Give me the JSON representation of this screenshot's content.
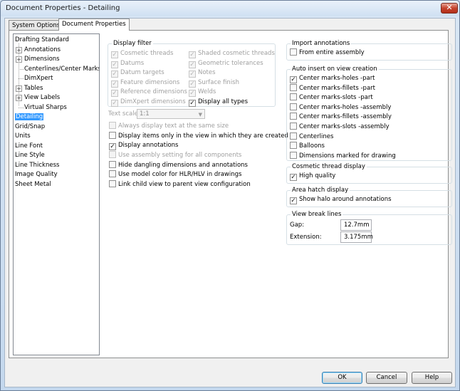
{
  "window": {
    "title": "Document Properties - Detailing",
    "close_glyph": "✕"
  },
  "tabs": [
    {
      "label": "System Options"
    },
    {
      "label": "Document Properties"
    }
  ],
  "tree": {
    "items": [
      {
        "label": "Drafting Standard"
      },
      {
        "label": "Annotations"
      },
      {
        "label": "Dimensions"
      },
      {
        "label": "Centerlines/Center Marks"
      },
      {
        "label": "DimXpert"
      },
      {
        "label": "Tables"
      },
      {
        "label": "View Labels"
      },
      {
        "label": "Virtual Sharps"
      },
      {
        "label": "Detailing",
        "selected": true
      },
      {
        "label": "Grid/Snap"
      },
      {
        "label": "Units"
      },
      {
        "label": "Line Font"
      },
      {
        "label": "Line Style"
      },
      {
        "label": "Line Thickness"
      },
      {
        "label": "Image Quality"
      },
      {
        "label": "Sheet Metal"
      }
    ],
    "expander_glyph": "+"
  },
  "display_filter": {
    "title": "Display filter",
    "left": [
      {
        "label": "Cosmetic threads",
        "checked": true,
        "enabled": false
      },
      {
        "label": "Datums",
        "checked": true,
        "enabled": false
      },
      {
        "label": "Datum targets",
        "checked": true,
        "enabled": false
      },
      {
        "label": "Feature dimensions",
        "checked": true,
        "enabled": false
      },
      {
        "label": "Reference dimensions",
        "checked": true,
        "enabled": false
      },
      {
        "label": "DimXpert dimensions",
        "checked": true,
        "enabled": false
      }
    ],
    "right": [
      {
        "label": "Shaded cosmetic threads",
        "checked": true,
        "enabled": false
      },
      {
        "label": "Geometric tolerances",
        "checked": true,
        "enabled": false
      },
      {
        "label": "Notes",
        "checked": true,
        "enabled": false
      },
      {
        "label": "Surface finish",
        "checked": true,
        "enabled": false
      },
      {
        "label": "Welds",
        "checked": true,
        "enabled": false
      },
      {
        "label": "Display all types",
        "checked": true,
        "enabled": true
      }
    ]
  },
  "text_scale": {
    "label": "Text scale:",
    "value": "1:1"
  },
  "options": [
    {
      "label": "Always display text at the same size",
      "checked": false,
      "enabled": false
    },
    {
      "label": "Display items only in the view in which they are created",
      "checked": false,
      "enabled": true
    },
    {
      "label": "Display annotations",
      "checked": true,
      "enabled": true
    },
    {
      "label": "Use assembly setting for all components",
      "checked": false,
      "enabled": false
    },
    {
      "label": "Hide dangling dimensions and annotations",
      "checked": false,
      "enabled": true
    },
    {
      "label": "Use model color for HLR/HLV in drawings",
      "checked": false,
      "enabled": true
    },
    {
      "label": "Link child view to parent view configuration",
      "checked": false,
      "enabled": true
    }
  ],
  "import_annotations": {
    "title": "Import annotations",
    "items": [
      {
        "label": "From entire assembly",
        "checked": false
      }
    ]
  },
  "auto_insert": {
    "title": "Auto insert on view creation",
    "items": [
      {
        "label": "Center marks-holes -part",
        "checked": true
      },
      {
        "label": "Center marks-fillets -part",
        "checked": false
      },
      {
        "label": "Center marks-slots  -part",
        "checked": false
      },
      {
        "label": "Center marks-holes -assembly",
        "checked": false
      },
      {
        "label": "Center marks-fillets -assembly",
        "checked": false
      },
      {
        "label": "Center marks-slots -assembly",
        "checked": false
      },
      {
        "label": "Centerlines",
        "checked": false
      },
      {
        "label": "Balloons",
        "checked": false
      },
      {
        "label": "Dimensions marked for drawing",
        "checked": false
      }
    ]
  },
  "cosmetic_thread": {
    "title": "Cosmetic thread display",
    "items": [
      {
        "label": "High quality",
        "checked": true
      }
    ]
  },
  "area_hatch": {
    "title": "Area hatch display",
    "items": [
      {
        "label": "Show halo around annotations",
        "checked": true
      }
    ]
  },
  "view_break": {
    "title": "View break lines",
    "gap_label": "Gap:",
    "gap_value": "12.7mm",
    "extension_label": "Extension:",
    "extension_value": "3.175mm"
  },
  "buttons": {
    "ok": "OK",
    "cancel": "Cancel",
    "help": "Help"
  },
  "check_glyph": "✓"
}
